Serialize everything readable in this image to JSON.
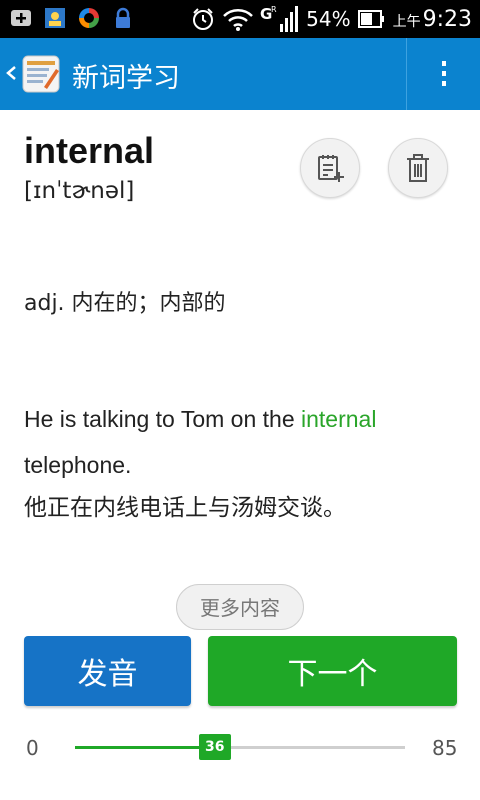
{
  "status_bar": {
    "battery_percent": "54%",
    "time_period": "上午",
    "time": "9:23"
  },
  "app_bar": {
    "title": "新词学习"
  },
  "word": {
    "text": "internal",
    "phonetic": "[ɪnˈtɚnəl]"
  },
  "definition": "adj. 内在的；内部的",
  "example": {
    "before": "He is talking to Tom on the ",
    "highlight": "internal",
    "after": " telephone.",
    "highlight_color": "#2aa52a",
    "translation": "他正在内线电话上与汤姆交谈。"
  },
  "more_button": {
    "label": "更多内容"
  },
  "buttons": {
    "speak_label": "发音",
    "next_label": "下一个"
  },
  "progress": {
    "min": "0",
    "max": "85",
    "current": "36",
    "fraction": 0.4235
  },
  "colors": {
    "app_bar": "#0b83cf",
    "speak_button": "#1673c6",
    "next_button": "#1fa827"
  }
}
